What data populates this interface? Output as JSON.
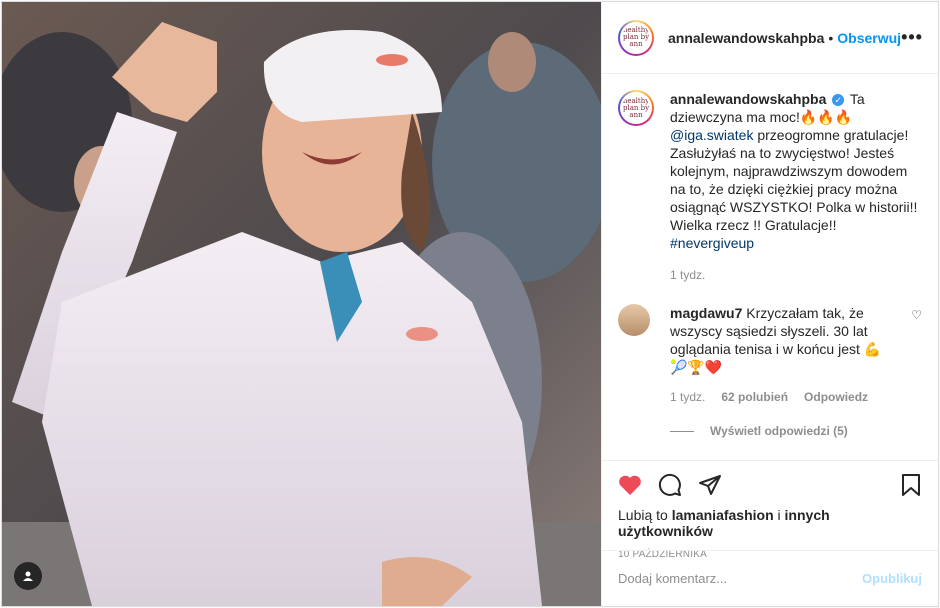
{
  "header": {
    "username": "annalewandowskahpba",
    "separator": "•",
    "follow_label": "Obserwuj",
    "more_label": "•••",
    "avatar_text": "healthy plan by ann"
  },
  "caption": {
    "username": "annalewandowskahpba",
    "verified": "✓",
    "text_a": "Ta dziewczyna ma moc!🔥🔥🔥",
    "mention": "@iga.swiatek",
    "text_b": "przeogromne gratulacje! Zasłużyłaś na to zwycięstwo! Jesteś kolejnym, najprawdziwszym dowodem na to, że dzięki ciężkiej pracy można osiągnąć WSZYSTKO! Polka w historii!! Wielka rzecz !! Gratulacje!!",
    "hashtag": "#nevergiveup",
    "time": "1 tydz."
  },
  "comment": {
    "username": "magdawu7",
    "text": "Krzyczałam tak, że wszyscy sąsiedzi słyszeli. 30 lat oglądania tenisa i w końcu jest 💪🎾🏆❤️",
    "time": "1 tydz.",
    "likes": "62 polubień",
    "reply": "Odpowiedz",
    "view_replies": "Wyświetl odpowiedzi (5)"
  },
  "likes": {
    "prefix": "Lubią to",
    "user": "lamaniafashion",
    "connector": "i",
    "others": "innych użytkowników"
  },
  "date": "10 PAŹDZIERNIKA",
  "add_comment": {
    "placeholder": "Dodaj komentarz...",
    "publish": "Opublikuj"
  },
  "colors": {
    "accent": "#0095f6",
    "like": "#ed4956",
    "muted": "#8e8e8e"
  },
  "icons": [
    "heart-icon",
    "comment-icon",
    "share-icon",
    "bookmark-icon",
    "user-tag-icon",
    "more-icon",
    "verified-icon"
  ]
}
